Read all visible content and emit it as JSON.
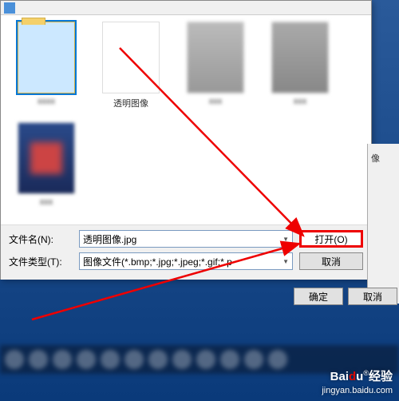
{
  "dialog": {
    "files": {
      "item2_label": "透明图像"
    },
    "filename_label": "文件名(N):",
    "filename_value": "透明图像.jpg",
    "filetype_label": "文件类型(T):",
    "filetype_value": "图像文件(*.bmp;*.jpg;*.jpeg;*.gif;*.p",
    "open_button": "打开(O)",
    "cancel_button": "取消"
  },
  "side": {
    "label1": "像",
    "label2": ":"
  },
  "second_dialog": {
    "ok": "确定",
    "cancel": "取消"
  },
  "watermark": {
    "brand": "Baidu 经验",
    "url": "jingyan.baidu.com"
  }
}
